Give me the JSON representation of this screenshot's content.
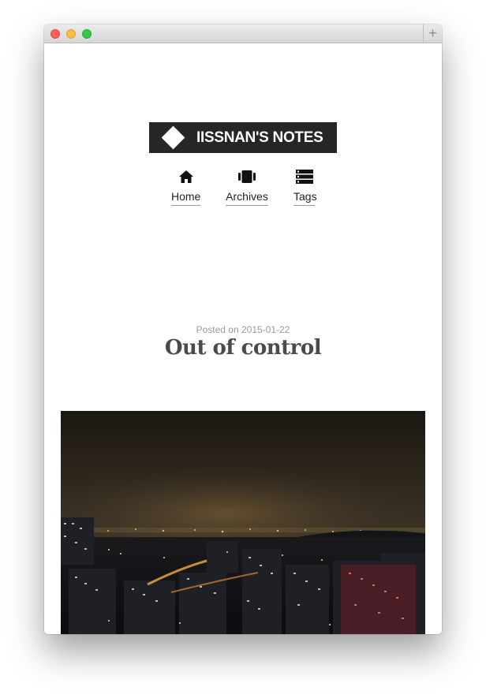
{
  "site": {
    "title": "IISSNAN'S NOTES"
  },
  "nav": {
    "items": [
      {
        "label": "Home",
        "icon": "home-icon"
      },
      {
        "label": "Archives",
        "icon": "archive-icon"
      },
      {
        "label": "Tags",
        "icon": "tags-icon"
      }
    ]
  },
  "post": {
    "posted_on": "Posted on 2015-01-22",
    "title": "Out of control"
  },
  "photo": {
    "subject": "night cityscape"
  },
  "window": {
    "new_tab_symbol": "+"
  },
  "colors": {
    "logo_bg": "#262626",
    "title_text": "#4a4a4a",
    "meta_text": "#9a9a9a"
  }
}
